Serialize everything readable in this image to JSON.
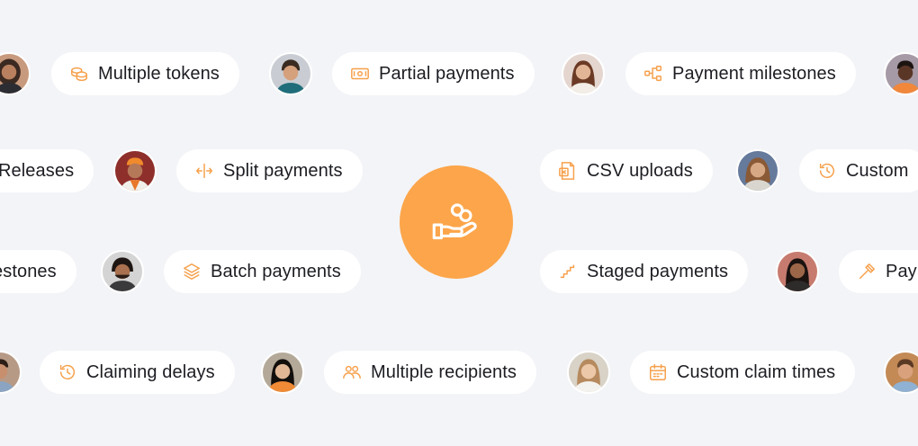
{
  "accent": "#fca54a",
  "center": {
    "icon": "hand-coins-icon"
  },
  "pills": {
    "multiple_tokens": {
      "label": "Multiple tokens",
      "icon": "coins-icon"
    },
    "partial_payments": {
      "label": "Partial payments",
      "icon": "banknote-icon"
    },
    "payment_milestones": {
      "label": "Payment milestones",
      "icon": "flow-icon"
    },
    "releases": {
      "label": "Releases"
    },
    "split_payments": {
      "label": "Split payments",
      "icon": "split-arrows-icon"
    },
    "csv_uploads": {
      "label": "CSV uploads",
      "icon": "spreadsheet-icon"
    },
    "custom": {
      "label": "Custom",
      "icon": "history-icon"
    },
    "estones": {
      "label": "estones"
    },
    "batch_payments": {
      "label": "Batch payments",
      "icon": "layers-icon"
    },
    "staged_payments": {
      "label": "Staged payments",
      "icon": "stairs-icon"
    },
    "pay": {
      "label": "Pay",
      "icon": "hammer-icon"
    },
    "claiming_delays": {
      "label": "Claiming delays",
      "icon": "history-icon"
    },
    "multiple_recipients": {
      "label": "Multiple recipients",
      "icon": "users-icon"
    },
    "custom_claim_times": {
      "label": "Custom claim times",
      "icon": "calendar-icon"
    }
  }
}
